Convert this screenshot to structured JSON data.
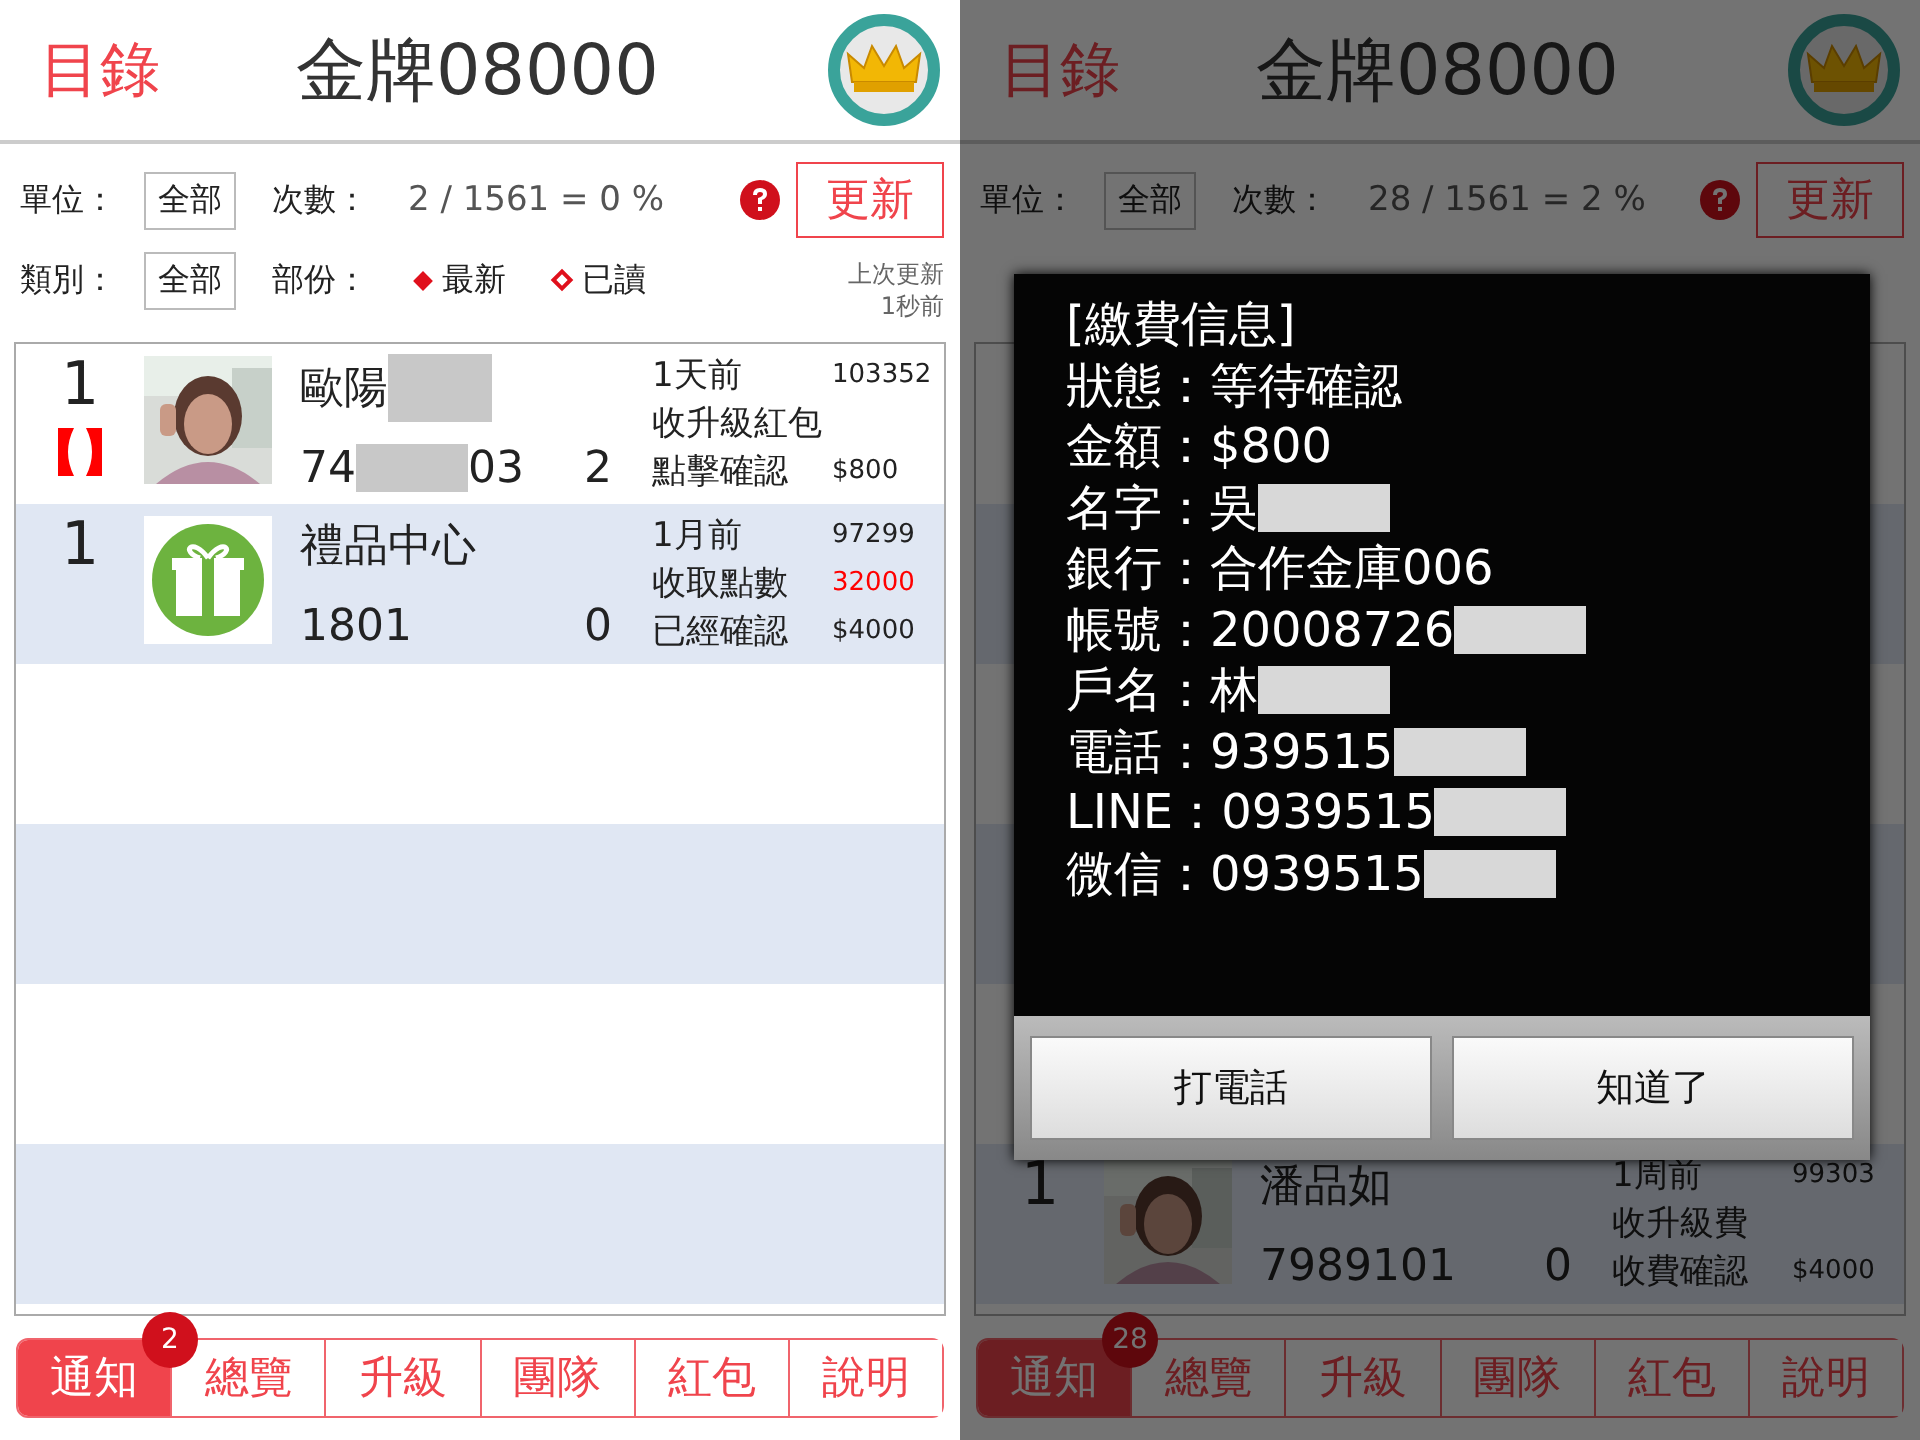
{
  "screens": [
    {
      "header": {
        "menu": "目錄",
        "title": "金牌08000"
      },
      "filters": {
        "unit_label": "單位：",
        "unit_value": "全部",
        "count_label": "次數：",
        "count_value": "2 / 1561 = 0 %",
        "category_label": "類別：",
        "category_value": "全部",
        "part_label": "部份：",
        "legend": [
          {
            "kind": "filled",
            "label": "最新"
          },
          {
            "kind": "outline",
            "label": "已讀"
          }
        ],
        "refresh": "更新",
        "last_update": "上次更新",
        "last_update_time": "1秒前"
      },
      "rows": [
        {
          "rank": "1",
          "flagged": true,
          "name": "歐陽",
          "name_redacted": true,
          "id_start": "74",
          "id_redacted": true,
          "id_end": "03",
          "count": "2",
          "time": "1天前",
          "order": "103352",
          "action": "收升級紅包",
          "status": "點擊確認",
          "amount": "$800"
        },
        {
          "rank": "1",
          "flagged": false,
          "avatar": {
            "kind": "gift"
          },
          "name": "禮品中心",
          "name_redacted": false,
          "id_start": "1801",
          "id_redacted": false,
          "count": "0",
          "time": "1月前",
          "order": "97299",
          "action": "收取點數",
          "points": "32000",
          "status": "已經確認",
          "amount": "$4000"
        }
      ],
      "tabs": [
        {
          "label": "通知",
          "selected": true,
          "badge": "2"
        },
        {
          "label": "總覽",
          "selected": false
        },
        {
          "label": "升級",
          "selected": false
        },
        {
          "label": "團隊",
          "selected": false
        },
        {
          "label": "紅包",
          "selected": false
        },
        {
          "label": "說明",
          "selected": false
        }
      ]
    },
    {
      "header": {
        "menu": "目錄",
        "title": "金牌08000"
      },
      "filters": {
        "unit_label": "單位：",
        "unit_value": "全部",
        "count_label": "次數：",
        "count_value": "28 / 1561 = 2 %",
        "refresh": "更新"
      },
      "rows": [
        {
          "rank": "1",
          "flagged": false,
          "name": "潘品如",
          "name_redacted": false,
          "id_start": "7989101",
          "id_redacted": false,
          "count": "0",
          "time": "1周前",
          "order": "99303",
          "action": "收升級費",
          "status": "收費確認",
          "amount": "$4000"
        }
      ],
      "tabs": [
        {
          "label": "通知",
          "selected": true,
          "badge": "28"
        },
        {
          "label": "總覽",
          "selected": false
        },
        {
          "label": "升級",
          "selected": false
        },
        {
          "label": "團隊",
          "selected": false
        },
        {
          "label": "紅包",
          "selected": false
        },
        {
          "label": "說明",
          "selected": false
        }
      ],
      "dialog": {
        "title": "[繳費信息]",
        "lines": [
          {
            "label": "狀態：",
            "value": "等待確認",
            "redacted": false
          },
          {
            "label": "金額：",
            "value": "$800",
            "redacted": false
          },
          {
            "label": "名字：",
            "value": "吳",
            "redacted": true
          },
          {
            "label": "銀行：",
            "value": "合作金庫006",
            "redacted": false
          },
          {
            "label": "帳號：",
            "value": "20008726",
            "redacted": true
          },
          {
            "label": "戶名：",
            "value": "林",
            "redacted": true
          },
          {
            "label": "電話：",
            "value": "939515",
            "redacted": true
          },
          {
            "label": "LINE：",
            "value": "0939515",
            "redacted": true
          },
          {
            "label": "微信：",
            "value": "0939515",
            "redacted": true
          }
        ],
        "buttons": [
          "打電話",
          "知道了"
        ]
      }
    }
  ]
}
